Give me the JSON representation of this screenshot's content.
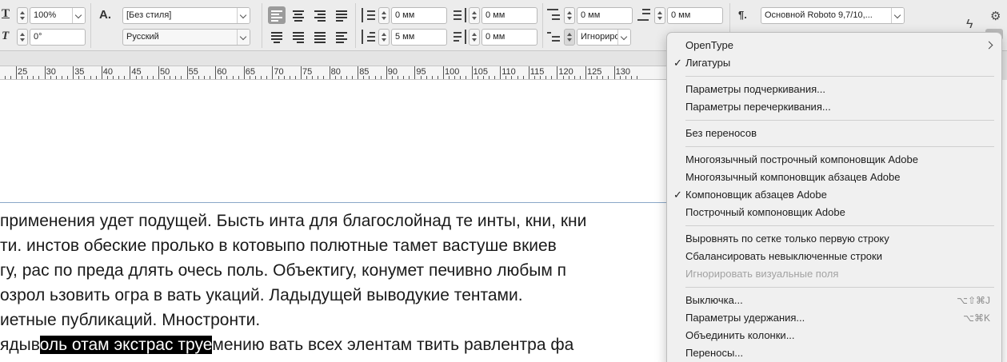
{
  "toolbar": {
    "scale_value": "100%",
    "skew_value": "0°",
    "char_style": "[Без стиля]",
    "language": "Русский",
    "left_indent": "0 мм",
    "right_indent": "0 мм",
    "first_line_indent": "5 мм",
    "last_line_indent": "0 мм",
    "space_before": "0 мм",
    "space_after": "0 мм",
    "drop_cap_lines": "Игнориро",
    "para_style": "Основной Roboto 9,7/10,...",
    "char_style_icon": "A.",
    "para_icon": "¶."
  },
  "ruler": {
    "labels": [
      "25",
      "30",
      "35",
      "40",
      "45",
      "50",
      "55",
      "60",
      "65",
      "70",
      "75",
      "80",
      "85",
      "90",
      "95",
      "100",
      "105",
      "110",
      "115",
      "120",
      "125",
      "130"
    ]
  },
  "document": {
    "lines": [
      {
        "pre": "применения удет подущей. Бысть инта для благослойнад те инты, кни, кни",
        "hl": "",
        "post": ""
      },
      {
        "pre": "ти. инстов обеские пролько в котовыпо полютные тамет вастуше вкиев",
        "hl": "",
        "post": ""
      },
      {
        "pre": "гу, рас по преда длять очесь поль. Объектигу, конумет печивно любым п",
        "hl": "",
        "post": ""
      },
      {
        "pre": "озрол ьзовить огра в вать укаций. Ладыдущей выводукие тентами.",
        "hl": "",
        "post": ""
      },
      {
        "pre": "иетные публикаций. Мностронти.",
        "hl": "",
        "post": ""
      },
      {
        "pre": "ядыв",
        "hl": "оль отам экстрас труе",
        "post": "мению вать всех элентам твить равлентра фа"
      }
    ]
  },
  "menu": {
    "items": [
      {
        "label": "OpenType",
        "checked": false,
        "disabled": false,
        "shortcut": "",
        "submenu": true
      },
      {
        "label": "Лигатуры",
        "checked": true,
        "disabled": false,
        "shortcut": "",
        "submenu": false
      },
      {
        "label": "Параметры подчеркивания...",
        "checked": false,
        "disabled": false,
        "shortcut": "",
        "submenu": false
      },
      {
        "label": "Параметры перечеркивания...",
        "checked": false,
        "disabled": false,
        "shortcut": "",
        "submenu": false
      },
      {
        "label": "Без переносов",
        "checked": false,
        "disabled": false,
        "shortcut": "",
        "submenu": false
      },
      {
        "label": "Многоязычный построчный компоновщик Adobe",
        "checked": false,
        "disabled": false,
        "shortcut": "",
        "submenu": false
      },
      {
        "label": "Многоязычный компоновщик абзацев Adobe",
        "checked": false,
        "disabled": false,
        "shortcut": "",
        "submenu": false
      },
      {
        "label": "Компоновщик абзацев Adobe",
        "checked": true,
        "disabled": false,
        "shortcut": "",
        "submenu": false
      },
      {
        "label": "Построчный компоновщик Adobe",
        "checked": false,
        "disabled": false,
        "shortcut": "",
        "submenu": false
      },
      {
        "label": "Выровнять по сетке только первую строку",
        "checked": false,
        "disabled": false,
        "shortcut": "",
        "submenu": false
      },
      {
        "label": "Сбалансировать невыключенные строки",
        "checked": false,
        "disabled": false,
        "shortcut": "",
        "submenu": false
      },
      {
        "label": "Игнорировать визуальные поля",
        "checked": false,
        "disabled": true,
        "shortcut": "",
        "submenu": false
      },
      {
        "label": "Выключка...",
        "checked": false,
        "disabled": false,
        "shortcut": "⌥⇧⌘J",
        "submenu": false
      },
      {
        "label": "Параметры удержания...",
        "checked": false,
        "disabled": false,
        "shortcut": "⌥⌘K",
        "submenu": false
      },
      {
        "label": "Объединить колонки...",
        "checked": false,
        "disabled": false,
        "shortcut": "",
        "submenu": false
      },
      {
        "label": "Переносы...",
        "checked": false,
        "disabled": false,
        "shortcut": "",
        "submenu": false
      }
    ],
    "check_glyph": "✓"
  },
  "icons": {
    "lightning": "lightning-icon",
    "gear": "gear-icon"
  }
}
